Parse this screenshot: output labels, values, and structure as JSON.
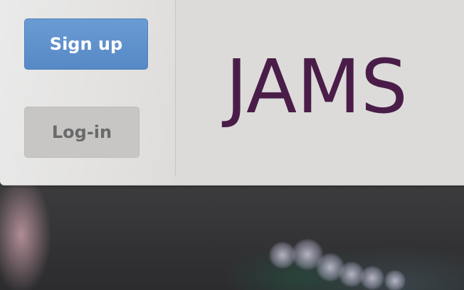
{
  "header": {
    "signup_label": "Sign up",
    "login_label": "Log-in",
    "brand_title": "JAMS"
  },
  "colors": {
    "signup_button": "#5b8ecb",
    "login_button": "#c7c6c5",
    "brand_text": "#4a1d49",
    "header_panel": "#dcdbd9"
  }
}
